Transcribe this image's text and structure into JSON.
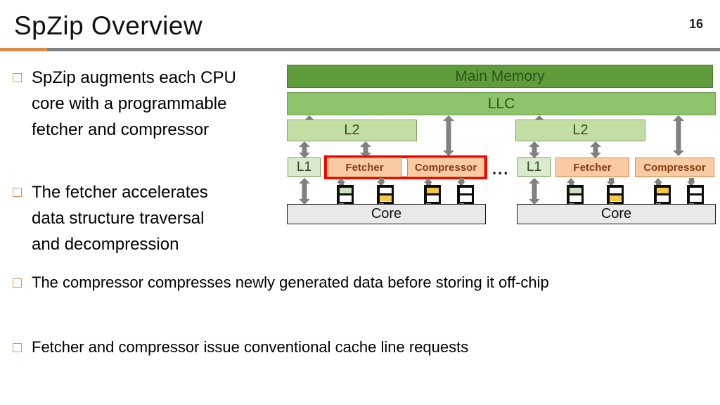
{
  "header": {
    "title": "SpZip Overview",
    "page_number": "16",
    "accent_orange": "#e08b48",
    "rule_gray": "#808080"
  },
  "bullets": [
    {
      "id": "b1",
      "text": "SpZip augments each CPU\ncore with a programmable\nfetcher and compressor"
    },
    {
      "id": "b2",
      "text": "The fetcher accelerates\ndata structure traversal\nand decompression"
    },
    {
      "id": "b3",
      "text": "The compressor compresses newly generated data before storing it off-chip"
    },
    {
      "id": "b4",
      "text": "Fetcher and compressor issue conventional cache line requests"
    }
  ],
  "diagram": {
    "main_memory": "Main Memory",
    "llc": "LLC",
    "ellipsis": "...",
    "cores": [
      {
        "l2": "L2",
        "l1": "L1",
        "fetcher": "Fetcher",
        "compressor": "Compressor",
        "core": "Core",
        "highlighted": true
      },
      {
        "l2": "L2",
        "l1": "L1",
        "fetcher": "Fetcher",
        "compressor": "Compressor",
        "core": "Core",
        "highlighted": false
      }
    ],
    "colors": {
      "main_memory_fill": "#5e9c3c",
      "llc_fill": "#8dc46b",
      "l2_fill": "#c3dea5",
      "l1_fill": "#d9ead0",
      "unit_fill": "#f9cba4",
      "unit_border": "#e08845",
      "unit_text": "#8a3b12",
      "core_fill": "#e9e9e9",
      "highlight_red": "#fe0000",
      "arrow_gray": "#808080",
      "queue_green": "#cfe0bd",
      "queue_yellow": "#f5c842"
    }
  }
}
